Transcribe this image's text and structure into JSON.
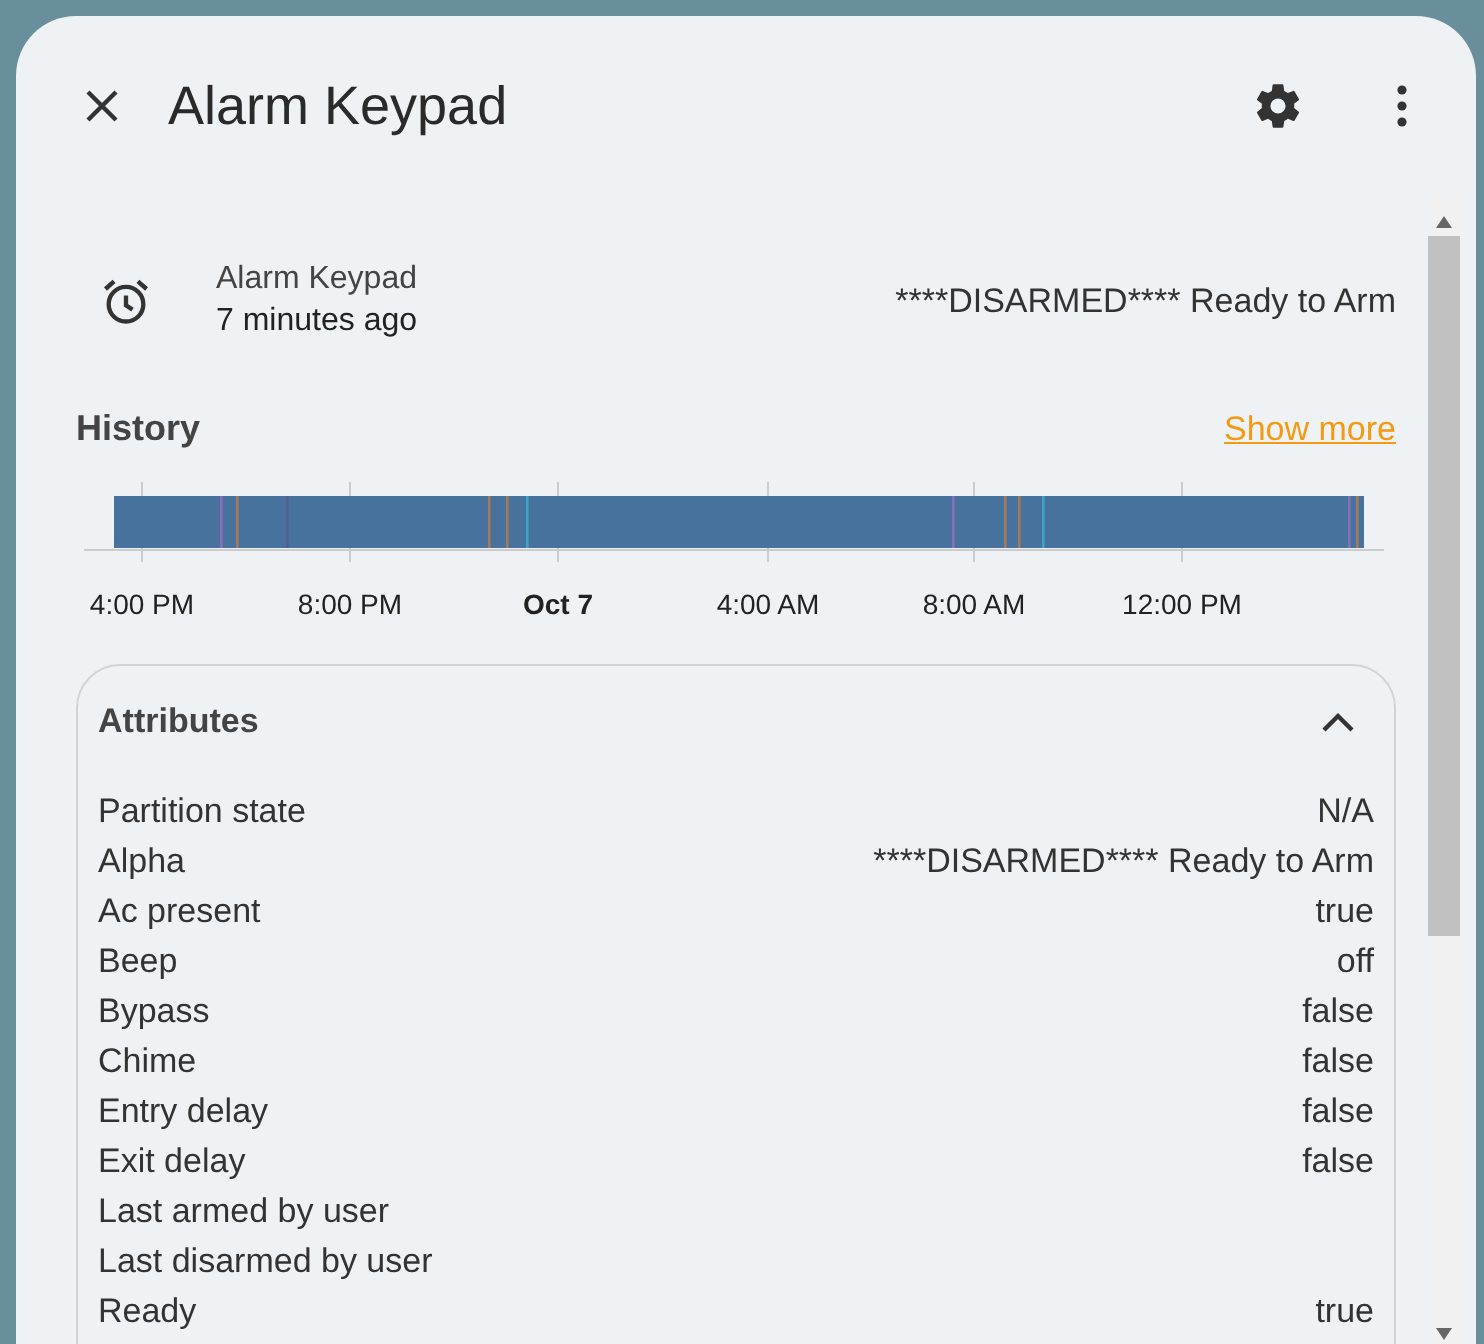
{
  "dialog": {
    "title": "Alarm Keypad"
  },
  "entity": {
    "name": "Alarm Keypad",
    "last_changed": "7 minutes ago",
    "state": "****DISARMED**** Ready to Arm"
  },
  "history": {
    "title": "History",
    "link": "Show more",
    "axis_labels": [
      {
        "text": "4:00 PM",
        "emphasized": false
      },
      {
        "text": "8:00 PM",
        "emphasized": false
      },
      {
        "text": "Oct 7",
        "emphasized": true
      },
      {
        "text": "4:00 AM",
        "emphasized": false
      },
      {
        "text": "8:00 AM",
        "emphasized": false
      },
      {
        "text": "12:00 PM",
        "emphasized": false
      }
    ]
  },
  "attributes": {
    "title": "Attributes",
    "expanded": true,
    "rows": [
      {
        "name": "Partition state",
        "value": "N/A"
      },
      {
        "name": "Alpha",
        "value": "****DISARMED**** Ready to Arm"
      },
      {
        "name": "Ac present",
        "value": "true"
      },
      {
        "name": "Beep",
        "value": "off"
      },
      {
        "name": "Bypass",
        "value": "false"
      },
      {
        "name": "Chime",
        "value": "false"
      },
      {
        "name": "Entry delay",
        "value": "false"
      },
      {
        "name": "Exit delay",
        "value": "false"
      },
      {
        "name": "Last armed by user",
        "value": ""
      },
      {
        "name": "Last disarmed by user",
        "value": ""
      },
      {
        "name": "Ready",
        "value": "true"
      }
    ]
  }
}
